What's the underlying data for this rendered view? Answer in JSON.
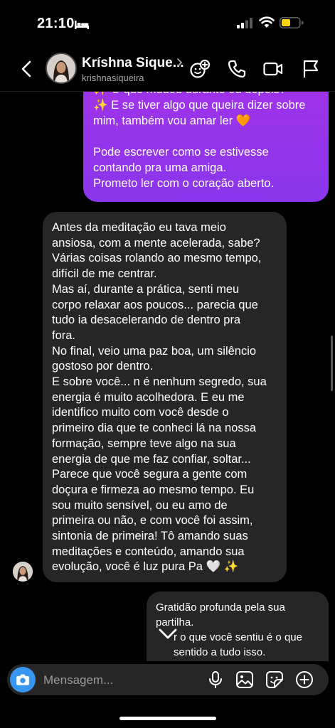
{
  "status_bar": {
    "time": "21:10"
  },
  "header": {
    "contact_name": "Kríshna Sique...",
    "contact_handle": "krishnasiqueira",
    "icons": [
      "back-icon",
      "emoji-effects-icon",
      "phone-icon",
      "video-camera-icon",
      "flag-icon"
    ]
  },
  "messages": {
    "outgoing_1": [
      "✨ O que mudou durante ou depois?",
      "✨ E se tiver algo que queira dizer sobre",
      "mim, também vou amar ler 🧡",
      "",
      "Pode escrever como se estivesse",
      "contando pra uma amiga.",
      "Prometo ler com o coração aberto."
    ],
    "incoming_1": [
      "Antes da meditação eu tava meio",
      "ansiosa, com a mente acelerada, sabe?",
      "Várias coisas rolando ao mesmo tempo,",
      "difícil de me centrar.",
      "Mas aí, durante a prática, senti meu",
      "corpo relaxar aos poucos... parecia que",
      "tudo ia desacelerando de dentro pra",
      "fora.",
      "No final, veio uma paz boa, um silêncio",
      "gostoso por dentro.",
      "E sobre você... n é nenhum segredo, sua",
      "energia é muito acolhedora. E eu me",
      "identifico muito com você desde o",
      "primeiro dia que te conheci lá na nossa",
      "formação, sempre teve algo na sua",
      "energia de que me faz confiar, soltar...",
      "Parece que você segura a gente com",
      "doçura e firmeza ao mesmo tempo. Eu",
      "sou muito sensível, ou eu amo de",
      "primeira ou não, e com você foi assim,",
      "sintonia de primeira! Tô amando suas",
      "meditações e conteúdo, amando sua",
      "evolução, você é luz pura Pa 🤍 ✨"
    ],
    "outgoing_2": [
      "Gratidão profunda pela sua",
      "partilha.",
      "      r o que você sentiu é o que",
      "      sentido a tudo isso."
    ]
  },
  "composer": {
    "placeholder": "Mensagem..."
  },
  "colors": {
    "accent_blue": "#3797f0",
    "outgoing_gradient_top": "#a132e8",
    "outgoing_gradient_bottom": "#8a36ec",
    "incoming_bubble": "#262626",
    "battery_low_power": "#ffd60a"
  }
}
